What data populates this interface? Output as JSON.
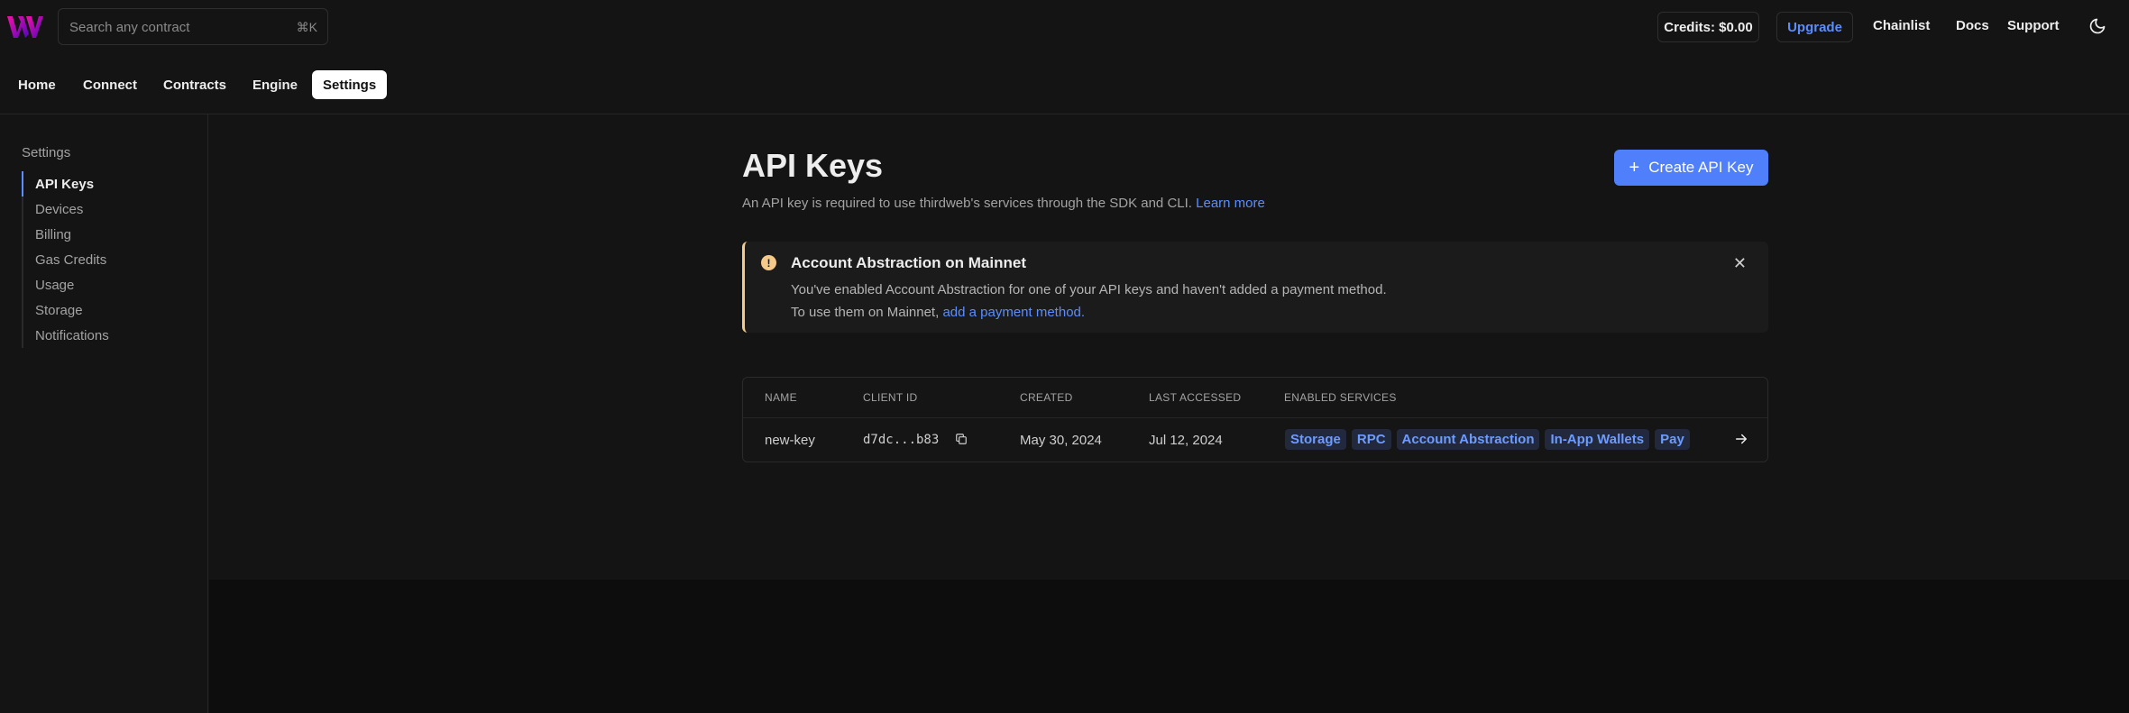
{
  "header": {
    "search_placeholder": "Search any contract",
    "search_shortcut": "⌘K",
    "credits_label": "Credits: $0.00",
    "upgrade_label": "Upgrade",
    "links": [
      "Chainlist",
      "Docs",
      "Support"
    ],
    "theme_icon": "moon-icon",
    "logo_icon": "thirdweb-logo"
  },
  "nav": {
    "tabs": [
      "Home",
      "Connect",
      "Contracts",
      "Engine",
      "Settings"
    ],
    "active": "Settings"
  },
  "sidebar": {
    "title": "Settings",
    "items": [
      "API Keys",
      "Devices",
      "Billing",
      "Gas Credits",
      "Usage",
      "Storage",
      "Notifications"
    ],
    "active": "API Keys"
  },
  "page": {
    "title": "API Keys",
    "subtitle": "An API key is required to use thirdweb's services through the SDK and CLI.",
    "learn_more": "Learn more",
    "create_button": "Create API Key"
  },
  "alert": {
    "title": "Account Abstraction on Mainnet",
    "line1": "You've enabled Account Abstraction for one of your API keys and haven't added a payment method.",
    "line2_prefix": "To use them on Mainnet,",
    "line2_link": "add a payment method.",
    "accent_color": "#f5c98a"
  },
  "table": {
    "columns": [
      "NAME",
      "CLIENT ID",
      "CREATED",
      "LAST ACCESSED",
      "ENABLED SERVICES"
    ],
    "rows": [
      {
        "name": "new-key",
        "client_id": "d7dc...b83",
        "created": "May 30, 2024",
        "last_accessed": "Jul 12, 2024",
        "services": [
          "Storage",
          "RPC",
          "Account Abstraction",
          "In-App Wallets",
          "Pay"
        ]
      }
    ]
  },
  "colors": {
    "accent": "#4f7ffb",
    "link": "#5b8dff",
    "background": "#141414"
  }
}
